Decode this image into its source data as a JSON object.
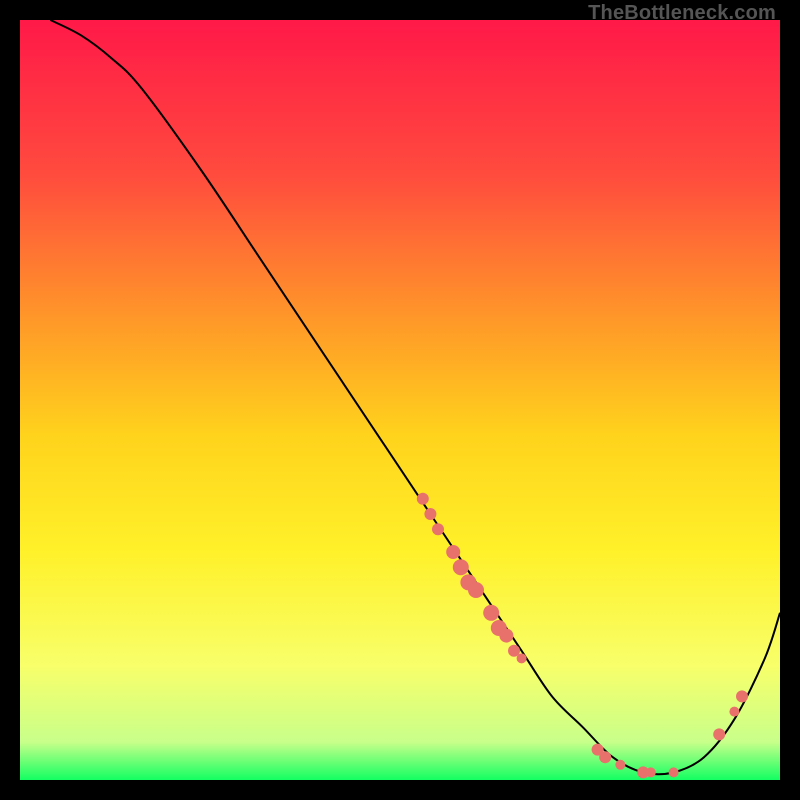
{
  "watermark": "TheBottleneck.com",
  "chart_data": {
    "type": "line",
    "title": "",
    "xlabel": "",
    "ylabel": "",
    "xlim": [
      0,
      100
    ],
    "ylim": [
      0,
      100
    ],
    "grid": false,
    "series": [
      {
        "name": "bottleneck-curve",
        "x": [
          4,
          8,
          12,
          16,
          24,
          32,
          40,
          48,
          54,
          58,
          62,
          66,
          70,
          74,
          78,
          82,
          86,
          90,
          94,
          98,
          100
        ],
        "y": [
          100,
          98,
          95,
          91,
          80,
          68,
          56,
          44,
          35,
          29,
          23,
          17,
          11,
          7,
          3,
          1,
          1,
          3,
          8,
          16,
          22
        ]
      }
    ],
    "markers": {
      "name": "highlighted-points",
      "color": "#e8716c",
      "points": [
        {
          "x": 53,
          "y": 37,
          "r": 6
        },
        {
          "x": 54,
          "y": 35,
          "r": 6
        },
        {
          "x": 55,
          "y": 33,
          "r": 6
        },
        {
          "x": 57,
          "y": 30,
          "r": 7
        },
        {
          "x": 58,
          "y": 28,
          "r": 8
        },
        {
          "x": 59,
          "y": 26,
          "r": 8
        },
        {
          "x": 60,
          "y": 25,
          "r": 8
        },
        {
          "x": 62,
          "y": 22,
          "r": 8
        },
        {
          "x": 63,
          "y": 20,
          "r": 8
        },
        {
          "x": 64,
          "y": 19,
          "r": 7
        },
        {
          "x": 65,
          "y": 17,
          "r": 6
        },
        {
          "x": 66,
          "y": 16,
          "r": 5
        },
        {
          "x": 76,
          "y": 4,
          "r": 6
        },
        {
          "x": 77,
          "y": 3,
          "r": 6
        },
        {
          "x": 79,
          "y": 2,
          "r": 5
        },
        {
          "x": 82,
          "y": 1,
          "r": 6
        },
        {
          "x": 83,
          "y": 1,
          "r": 5
        },
        {
          "x": 86,
          "y": 1,
          "r": 5
        },
        {
          "x": 92,
          "y": 6,
          "r": 6
        },
        {
          "x": 94,
          "y": 9,
          "r": 5
        },
        {
          "x": 95,
          "y": 11,
          "r": 6
        }
      ]
    },
    "gradient_stops": [
      {
        "offset": 0,
        "color": "#ff1948"
      },
      {
        "offset": 20,
        "color": "#ff4a3e"
      },
      {
        "offset": 40,
        "color": "#ff9a28"
      },
      {
        "offset": 55,
        "color": "#ffd41c"
      },
      {
        "offset": 70,
        "color": "#fff12a"
      },
      {
        "offset": 85,
        "color": "#f8ff6a"
      },
      {
        "offset": 95,
        "color": "#c8ff8a"
      },
      {
        "offset": 100,
        "color": "#13ff62"
      }
    ]
  }
}
